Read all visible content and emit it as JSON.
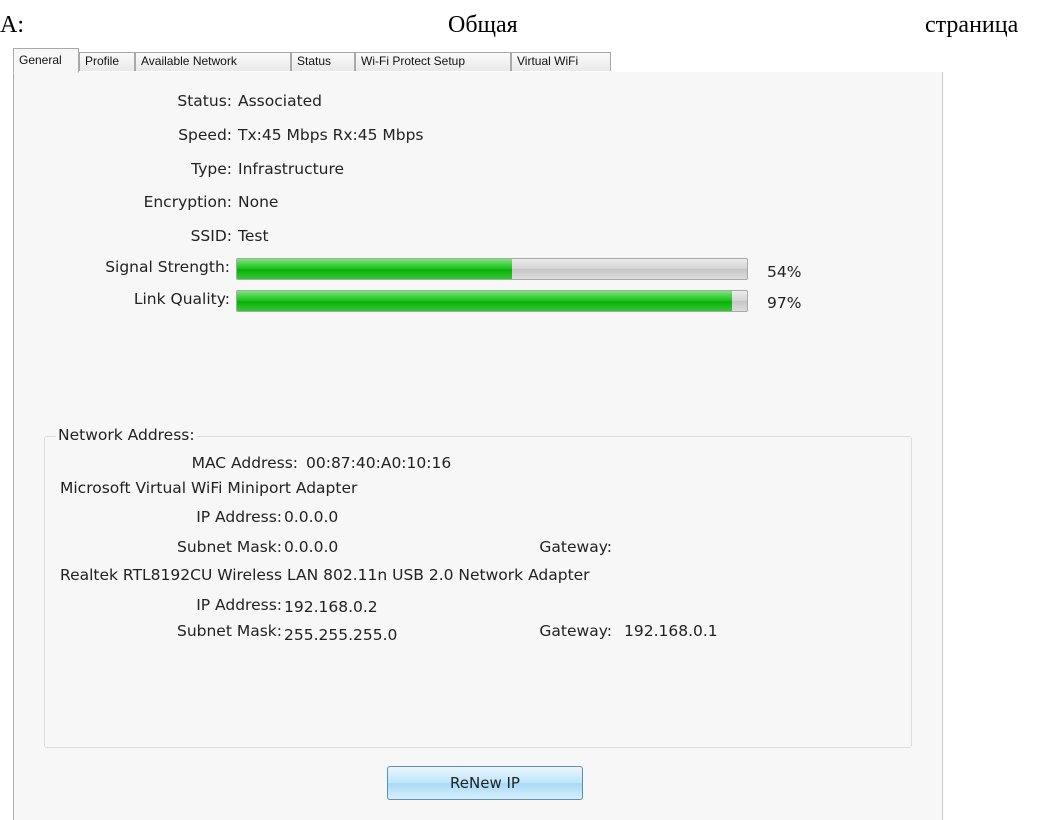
{
  "caption": {
    "left": "А:",
    "middle": "Общая",
    "right": "страница"
  },
  "tabs": [
    {
      "label": "General",
      "active": true
    },
    {
      "label": "Profile",
      "active": false
    },
    {
      "label": "Available Network",
      "active": false
    },
    {
      "label": "Status",
      "active": false
    },
    {
      "label": "Wi-Fi Protect Setup",
      "active": false
    },
    {
      "label": "Virtual WiFi",
      "active": false
    }
  ],
  "general": {
    "status_label": "Status:",
    "status_value": "Associated",
    "speed_label": "Speed:",
    "speed_value": "Tx:45 Mbps Rx:45 Mbps",
    "type_label": "Type:",
    "type_value": "Infrastructure",
    "encryption_label": "Encryption:",
    "encryption_value": "None",
    "ssid_label": "SSID:",
    "ssid_value": "Test",
    "signal_label": "Signal Strength:",
    "signal_percent_text": "54%",
    "signal_fraction": 0.54,
    "link_label": "Link Quality:",
    "link_percent_text": "97%",
    "link_fraction": 0.97
  },
  "network_address": {
    "title": "Network Address:",
    "mac_label": "MAC Address:",
    "mac_value": "00:87:40:A0:10:16",
    "adapter1_name": "Microsoft Virtual WiFi Miniport Adapter",
    "adapter1_ip_label": "IP Address:",
    "adapter1_ip": "0.0.0.0",
    "adapter1_subnet_label": "Subnet Mask:",
    "adapter1_subnet": "0.0.0.0",
    "adapter1_gateway_label": "Gateway:",
    "adapter1_gateway": "",
    "adapter2_name": "Realtek RTL8192CU Wireless LAN 802.11n USB 2.0 Network Adapter",
    "adapter2_ip_label": "IP Address:",
    "adapter2_ip": "192.168.0.2",
    "adapter2_subnet_label": "Subnet Mask:",
    "adapter2_subnet": "255.255.255.0",
    "adapter2_gateway_label": "Gateway:",
    "adapter2_gateway": "192.168.0.1"
  },
  "buttons": {
    "renew": "ReNew IP"
  },
  "colors": {
    "progress_fill": "#22c422",
    "button_border": "#5a8fb8",
    "panel_bg": "#f7f7f7"
  }
}
